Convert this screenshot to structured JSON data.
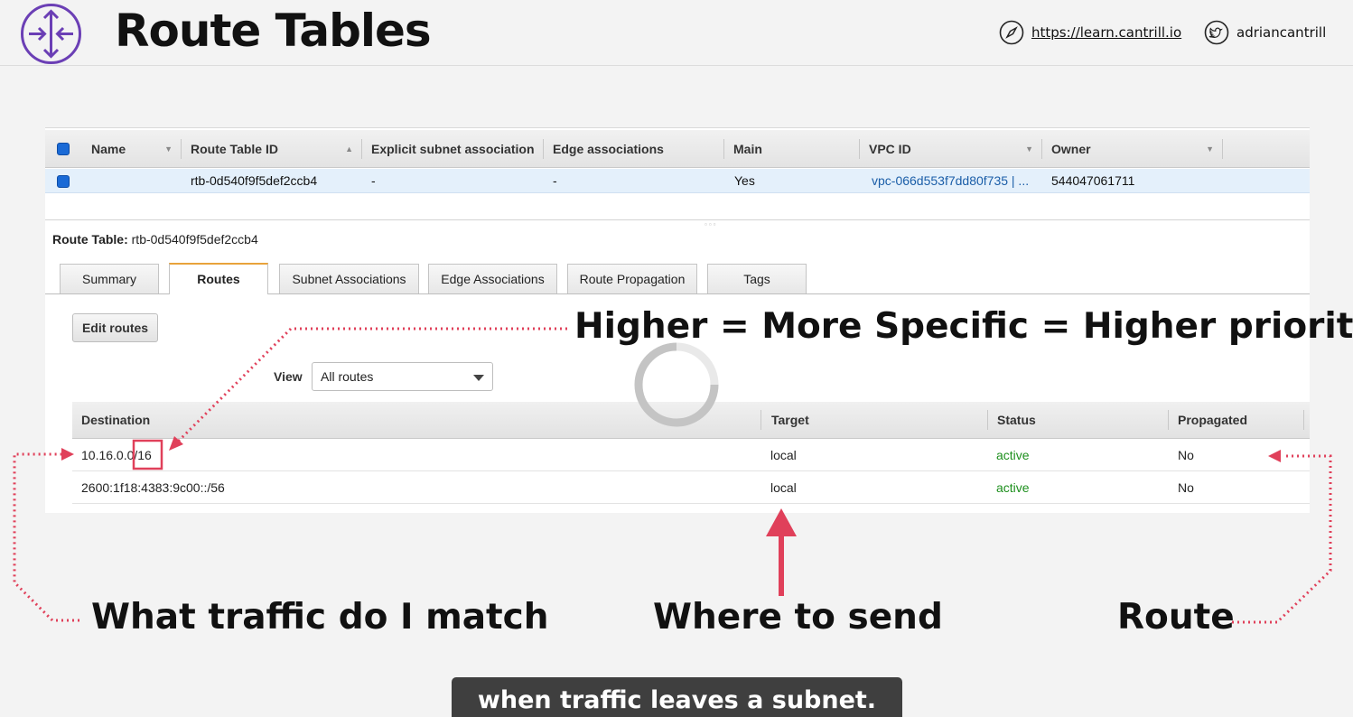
{
  "slide": {
    "title": "Route Tables",
    "site_url": "https://learn.cantrill.io",
    "twitter_handle": "adriancantrill"
  },
  "route_table_grid": {
    "columns": [
      "Name",
      "Route Table ID",
      "Explicit subnet association",
      "Edge associations",
      "Main",
      "VPC ID",
      "Owner"
    ],
    "row": {
      "name": "",
      "route_table_id": "rtb-0d540f9f5def2ccb4",
      "explicit_subnet_association": "-",
      "edge_associations": "-",
      "main": "Yes",
      "vpc_id": "vpc-066d553f7dd80f735 | ...",
      "owner": "544047061711"
    }
  },
  "detail": {
    "label": "Route Table:",
    "value": "rtb-0d540f9f5def2ccb4",
    "tabs": [
      "Summary",
      "Routes",
      "Subnet Associations",
      "Edge Associations",
      "Route Propagation",
      "Tags"
    ],
    "active_tab": "Routes",
    "edit_button": "Edit routes",
    "view_label": "View",
    "view_selected": "All routes"
  },
  "routes": {
    "columns": [
      "Destination",
      "Target",
      "Status",
      "Propagated"
    ],
    "rows": [
      {
        "destination": "10.16.0.0/16",
        "target": "local",
        "status": "active",
        "propagated": "No"
      },
      {
        "destination": "2600:1f18:4383:9c00::/56",
        "target": "local",
        "status": "active",
        "propagated": "No"
      }
    ]
  },
  "annotations": {
    "priority": "Higher = More Specific = Higher priority",
    "match": "What traffic do I match",
    "where": "Where to send",
    "route": "Route"
  },
  "caption": "when traffic leaves a subnet.",
  "colors": {
    "annotation_red": "#e0405a",
    "logo_purple": "#6b3fb5",
    "status_green": "#1d8f1d",
    "checkbox_blue": "#1a6ad6",
    "tab_accent": "#e8a33b"
  }
}
